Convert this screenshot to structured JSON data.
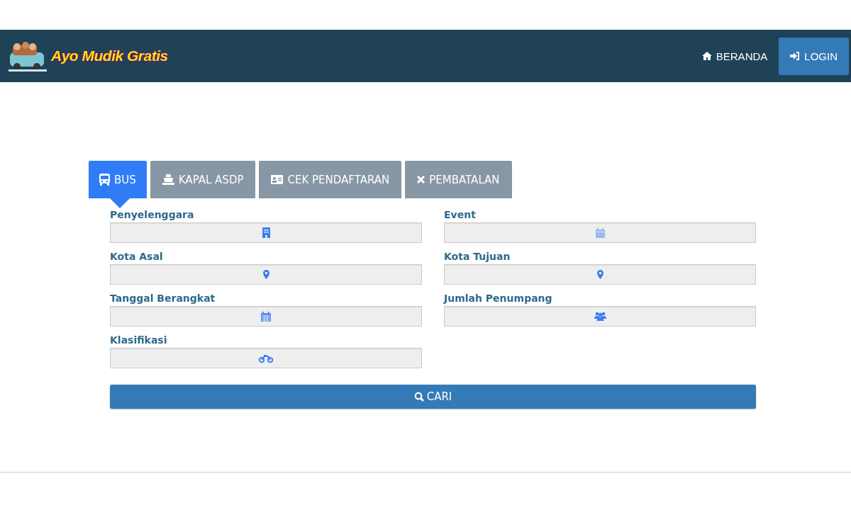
{
  "navbar": {
    "brand": "Ayo Mudik Gratis",
    "links": [
      {
        "label": "BERANDA",
        "kind": "link"
      },
      {
        "label": "LOGIN",
        "kind": "button"
      }
    ]
  },
  "tabs": [
    {
      "label": "BUS",
      "selected": true
    },
    {
      "label": "KAPAL ASDP",
      "selected": false
    },
    {
      "label": "CEK PENDAFTARAN",
      "selected": false
    },
    {
      "label": "PEMBATALAN",
      "selected": false
    }
  ],
  "form": {
    "fields": [
      {
        "label": "Penyelenggara"
      },
      {
        "label": "Event"
      },
      {
        "label": "Kota Asal"
      },
      {
        "label": "Kota Tujuan"
      },
      {
        "label": "Tanggal Berangkat"
      },
      {
        "label": "Jumlah Penumpang"
      },
      {
        "label": "Klasifikasi"
      }
    ],
    "submit": "CARI"
  }
}
